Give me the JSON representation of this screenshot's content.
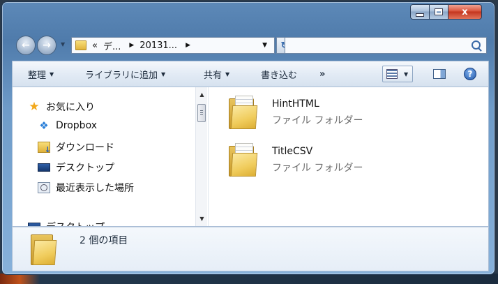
{
  "window": {
    "caption_min": "–",
    "caption_close": "x"
  },
  "address_bar": {
    "chevron": "«",
    "segments": [
      "デ...",
      "20131..."
    ]
  },
  "search": {
    "placeholder": ""
  },
  "toolbar": {
    "organize": "整理",
    "include_library": "ライブラリに追加",
    "share": "共有",
    "burn": "書き込む",
    "more": "»",
    "help": "?"
  },
  "nav_pane": {
    "favorites": "お気に入り",
    "items": [
      "Dropbox",
      "ダウンロード",
      "デスクトップ",
      "最近表示した場所"
    ],
    "partial_item": "デスクトップ"
  },
  "files": [
    {
      "name": "HintHTML",
      "type": "ファイル フォルダー"
    },
    {
      "name": "TitleCSV",
      "type": "ファイル フォルダー"
    }
  ],
  "details": {
    "item_count": "2 個の項目"
  },
  "colors": {
    "frame": "#6f9cc9",
    "close_button": "#c4361f",
    "folder": "#f0cc5c",
    "secondary_text": "#6d6d6d"
  },
  "icons": {
    "back": "back-arrow-icon",
    "forward": "forward-arrow-icon",
    "refresh": "refresh-icon",
    "search": "search-icon",
    "favorites": "star-icon",
    "dropbox": "dropbox-icon",
    "downloads": "downloads-folder-icon",
    "desktop": "desktop-icon",
    "recent": "recent-places-icon"
  }
}
